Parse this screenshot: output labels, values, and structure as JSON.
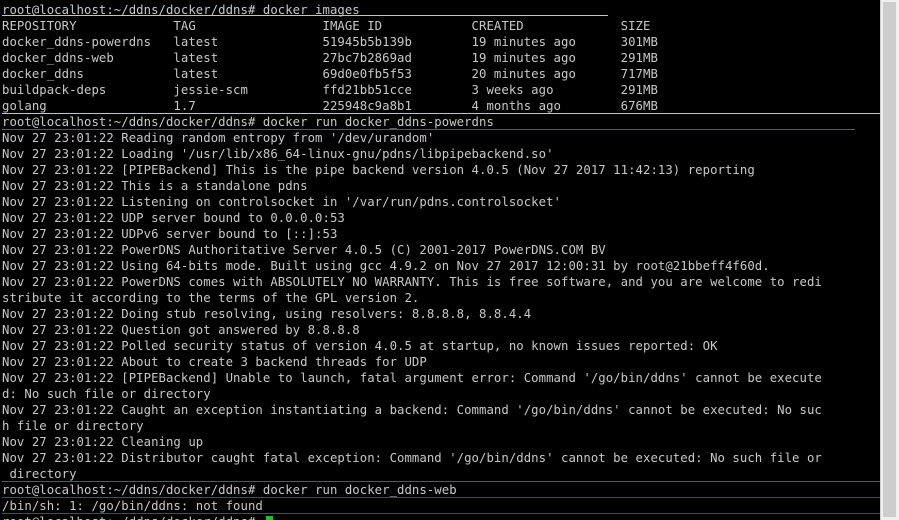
{
  "terminal": {
    "lines": [
      "root@localhost:~/ddns/docker/ddns# docker images",
      "REPOSITORY             TAG                 IMAGE ID            CREATED             SIZE",
      "docker_ddns-powerdns   latest              51945b5b139b        19 minutes ago      301MB",
      "docker_ddns-web        latest              27bc7b2869ad        19 minutes ago      291MB",
      "docker_ddns            latest              69d0e0fb5f53        20 minutes ago      717MB",
      "buildpack-deps         jessie-scm          ffd21bb51cce        3 weeks ago         291MB",
      "golang                 1.7                 225948c9a8b1        4 months ago        676MB",
      "root@localhost:~/ddns/docker/ddns# docker run docker_ddns-powerdns",
      "Nov 27 23:01:22 Reading random entropy from '/dev/urandom'",
      "Nov 27 23:01:22 Loading '/usr/lib/x86_64-linux-gnu/pdns/libpipebackend.so'",
      "Nov 27 23:01:22 [PIPEBackend] This is the pipe backend version 4.0.5 (Nov 27 2017 11:42:13) reporting",
      "Nov 27 23:01:22 This is a standalone pdns",
      "Nov 27 23:01:22 Listening on controlsocket in '/var/run/pdns.controlsocket'",
      "Nov 27 23:01:22 UDP server bound to 0.0.0.0:53",
      "Nov 27 23:01:22 UDPv6 server bound to [::]:53",
      "Nov 27 23:01:22 PowerDNS Authoritative Server 4.0.5 (C) 2001-2017 PowerDNS.COM BV",
      "Nov 27 23:01:22 Using 64-bits mode. Built using gcc 4.9.2 on Nov 27 2017 12:00:31 by root@21bbeff4f60d.",
      "Nov 27 23:01:22 PowerDNS comes with ABSOLUTELY NO WARRANTY. This is free software, and you are welcome to redi",
      "stribute it according to the terms of the GPL version 2.",
      "Nov 27 23:01:22 Doing stub resolving, using resolvers: 8.8.8.8, 8.8.4.4",
      "Nov 27 23:01:22 Question got answered by 8.8.8.8",
      "Nov 27 23:01:22 Polled security status of version 4.0.5 at startup, no known issues reported: OK",
      "Nov 27 23:01:22 About to create 3 backend threads for UDP",
      "Nov 27 23:01:22 [PIPEBackend] Unable to launch, fatal argument error: Command '/go/bin/ddns' cannot be execute",
      "d: No such file or directory",
      "Nov 27 23:01:22 Caught an exception instantiating a backend: Command '/go/bin/ddns' cannot be executed: No suc",
      "h file or directory",
      "Nov 27 23:01:22 Cleaning up",
      "Nov 27 23:01:22 Distributor caught fatal exception: Command '/go/bin/ddns' cannot be executed: No such file or",
      " directory",
      "root@localhost:~/ddns/docker/ddns# docker run docker_ddns-web",
      "/bin/sh: 1: /go/bin/ddns: not found",
      "root@localhost:~/ddns/docker/ddns# "
    ]
  },
  "colors": {
    "background": "#000000",
    "text": "#c8c8c8",
    "cursor": "#22c22a",
    "underline_yellow": "#e6d21e",
    "underline_red": "#e02020",
    "underline_blue": "#3a3ad8"
  }
}
